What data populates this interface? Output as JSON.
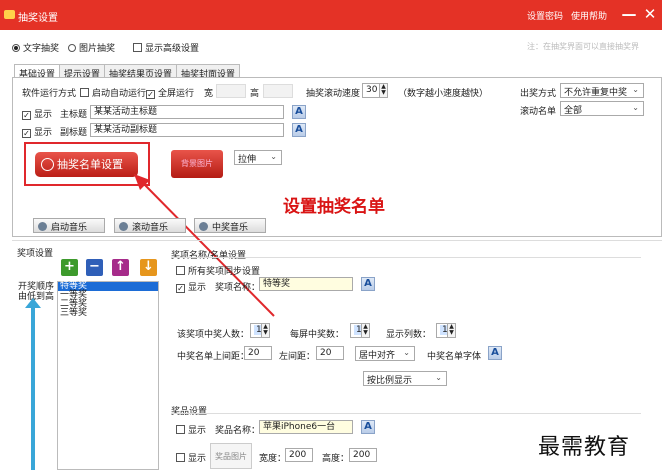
{
  "window": {
    "title": "抽奖设置",
    "links": {
      "password": "设置密码",
      "help": "使用帮助"
    },
    "minimize_glyph": "—",
    "close_glyph": "✕"
  },
  "mode_row": {
    "text_lottery": "文字抽奖",
    "image_lottery": "图片抽奖",
    "advanced": "显示高级设置",
    "note": "注：在抽奖界面可以直接抽奖界"
  },
  "tabs": [
    "基础设置",
    "提示设置",
    "抽奖结果页设置",
    "抽奖封面设置"
  ],
  "basic": {
    "run_mode_label": "软件运行方式",
    "auto_run": "启动自动运行",
    "fullscreen": "全屏运行",
    "width_label": "宽",
    "height_label": "高",
    "scroll_speed_label": "抽奖滚动速度",
    "scroll_speed_value": "30",
    "scroll_speed_hint": "（数字越小速度越快）",
    "draw_mode_label": "出奖方式",
    "draw_mode_value": "不允许重复中奖",
    "scroll_list_label": "滚动名单",
    "scroll_list_value": "全部",
    "show_label": "显示",
    "main_title_label": "主标题",
    "main_title_value": "某某活动主标题",
    "sub_title_label": "副标题",
    "sub_title_value": "某某活动副标题",
    "list_settings_button": "抽奖名单设置",
    "bg_image_button": "背景图片",
    "stretch_value": "拉伸",
    "music_start": "启动音乐",
    "music_scroll": "滚动音乐",
    "music_win": "中奖音乐"
  },
  "annotation": "设置抽奖名单",
  "prize": {
    "section_label": "奖项设置",
    "order_label_1": "开奖顺序",
    "order_label_2": "由低到高",
    "list_items": [
      "特等奖",
      "一等奖",
      "二等奖",
      "三等奖"
    ],
    "list_group_label": "奖项名称/名单设置",
    "sync_all": "所有奖项同步设置",
    "show_label": "显示",
    "name_label": "奖项名称：",
    "name_value": "特等奖",
    "winners_label": "该奖项中奖人数：",
    "winners_value": "1",
    "per_screen_label": "每屏中奖数：",
    "per_screen_value": "1",
    "columns_label": "显示列数：",
    "columns_value": "1",
    "top_margin_label": "中奖名单上间距：",
    "top_margin_value": "20",
    "left_margin_label": "左间距：",
    "left_margin_value": "20",
    "align_value": "居中对齐",
    "font_label": "中奖名单字体",
    "scale_value": "按比例显示",
    "goods_label": "奖品设置",
    "goods_name_label": "奖品名称：",
    "goods_name_value": "苹果iPhone6一台",
    "goods_image_label": "奖品图片",
    "goods_width_label": "宽度：",
    "goods_width_value": "200",
    "goods_height_label": "高度：",
    "goods_height_value": "200"
  },
  "watermark": "最需教育",
  "colors": {
    "titlebar": "#e43226",
    "annotation": "#d91414",
    "accent_button": "#c8231b"
  }
}
